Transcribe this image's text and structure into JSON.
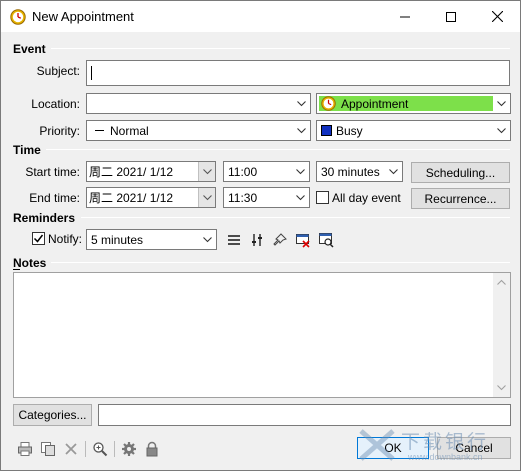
{
  "window": {
    "title": "New Appointment",
    "controls": [
      "minimize",
      "maximize",
      "close"
    ]
  },
  "event": {
    "section_label": "Event",
    "subject_label": "Subject:",
    "subject_value": "",
    "location_label": "Location:",
    "location_value": "",
    "label_value": "Appointment",
    "label_color": "#7de04a",
    "priority_label": "Priority:",
    "priority_value": "Normal",
    "show_as_value": "Busy",
    "show_as_color": "#1030c0"
  },
  "time": {
    "section_label": "Time",
    "start_label": "Start time:",
    "start_date": "周二 2021/  1/12",
    "start_time": "11:00",
    "duration": "30 minutes",
    "scheduling_button": "Scheduling...",
    "end_label": "End time:",
    "end_date": "周二 2021/  1/12",
    "end_time": "11:30",
    "all_day_label": "All day event",
    "all_day_checked": false,
    "recurrence_button": "Recurrence..."
  },
  "reminders": {
    "section_label": "Reminders",
    "notify_label": "Notify:",
    "notify_checked": true,
    "notify_value": "5 minutes"
  },
  "notes": {
    "section_label": "Notes",
    "value": ""
  },
  "categories": {
    "button_label": "Categories...",
    "value": ""
  },
  "footer": {
    "ok_label": "OK",
    "cancel_label": "Cancel",
    "watermark_text": "下载银行",
    "watermark_url": "www.downbank.cn"
  },
  "icons": [
    "clock-icon",
    "print-icon",
    "copy-icon",
    "delete-icon",
    "zoom-icon",
    "settings-icon",
    "lock-icon"
  ]
}
